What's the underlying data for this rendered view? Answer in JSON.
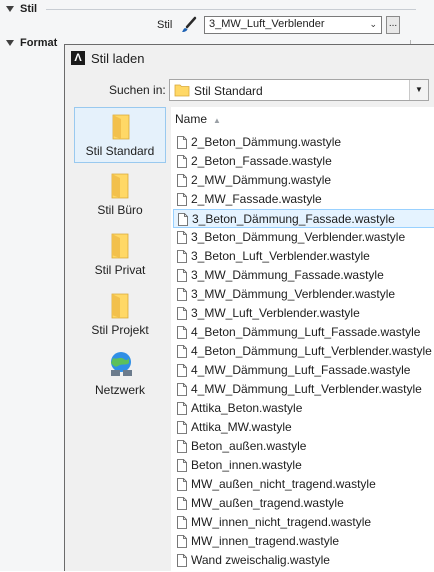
{
  "properties": {
    "stil_section": "Stil",
    "format_section": "Format",
    "stil_label": "Stil",
    "stil_value": "3_MW_Luft_Verblender",
    "more_button": "..."
  },
  "dialog": {
    "title": "Stil laden",
    "look_in_label": "Suchen in:",
    "look_in_value": "Stil Standard",
    "column_name": "Name",
    "places": [
      {
        "label": "Stil Standard",
        "icon": "folder-icon"
      },
      {
        "label": "Stil Büro",
        "icon": "folder-icon"
      },
      {
        "label": "Stil Privat",
        "icon": "folder-icon"
      },
      {
        "label": "Stil Projekt",
        "icon": "folder-icon"
      },
      {
        "label": "Netzwerk",
        "icon": "network-icon"
      }
    ],
    "selected_place": 0,
    "files": [
      "2_Beton_Dämmung.wastyle",
      "2_Beton_Fassade.wastyle",
      "2_MW_Dämmung.wastyle",
      "2_MW_Fassade.wastyle",
      "3_Beton_Dämmung_Fassade.wastyle",
      "3_Beton_Dämmung_Verblender.wastyle",
      "3_Beton_Luft_Verblender.wastyle",
      "3_MW_Dämmung_Fassade.wastyle",
      "3_MW_Dämmung_Verblender.wastyle",
      "3_MW_Luft_Verblender.wastyle",
      "4_Beton_Dämmung_Luft_Fassade.wastyle",
      "4_Beton_Dämmung_Luft_Verblender.wastyle",
      "4_MW_Dämmung_Luft_Fassade.wastyle",
      "4_MW_Dämmung_Luft_Verblender.wastyle",
      "Attika_Beton.wastyle",
      "Attika_MW.wastyle",
      "Beton_außen.wastyle",
      "Beton_innen.wastyle",
      "MW_außen_nicht_tragend.wastyle",
      "MW_außen_tragend.wastyle",
      "MW_innen_nicht_tragend.wastyle",
      "MW_innen_tragend.wastyle",
      "Wand zweischalig.wastyle"
    ],
    "selected_file": 4
  },
  "colors": {
    "selection_bg": "#e5f3ff",
    "selection_border": "#99d1ff",
    "folder_yellow": "#ffd866"
  }
}
